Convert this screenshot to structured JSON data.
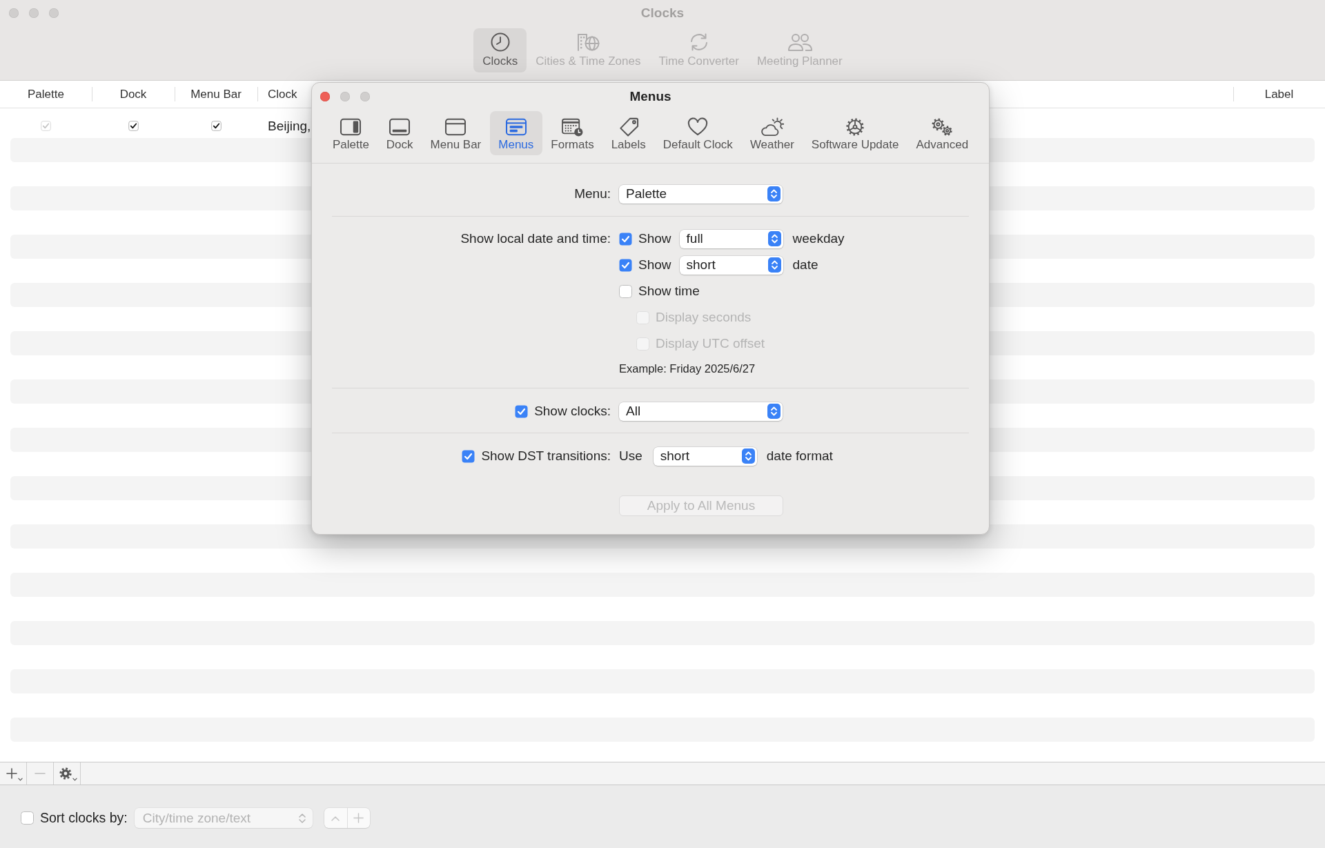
{
  "window": {
    "title": "Clocks"
  },
  "toolbar": [
    {
      "label": "Clocks",
      "selected": true
    },
    {
      "label": "Cities & Time Zones",
      "selected": false
    },
    {
      "label": "Time Converter",
      "selected": false
    },
    {
      "label": "Meeting Planner",
      "selected": false
    }
  ],
  "table": {
    "columns": [
      "Palette",
      "Dock",
      "Menu Bar",
      "Clock",
      "Label"
    ],
    "rows": [
      {
        "palette": {
          "checked": true,
          "disabled": true
        },
        "dock": {
          "checked": true,
          "disabled": false
        },
        "menu_bar": {
          "checked": true,
          "disabled": false
        },
        "clock": "Beijing,"
      }
    ]
  },
  "footer_buttons": [
    {
      "kind": "add",
      "disabled": false
    },
    {
      "kind": "remove",
      "disabled": true
    },
    {
      "kind": "action",
      "disabled": false
    }
  ],
  "sort": {
    "checked": false,
    "label": "Sort clocks by:",
    "popup": {
      "value": "City/time zone/text",
      "disabled": true
    },
    "segments": [
      {
        "kind": "ascending",
        "disabled": true
      },
      {
        "kind": "add",
        "disabled": true
      }
    ]
  },
  "dialog": {
    "title": "Menus",
    "tabs": [
      {
        "label": "Palette",
        "selected": false
      },
      {
        "label": "Dock",
        "selected": false
      },
      {
        "label": "Menu Bar",
        "selected": false
      },
      {
        "label": "Menus",
        "selected": true
      },
      {
        "label": "Formats",
        "selected": false
      },
      {
        "label": "Labels",
        "selected": false
      },
      {
        "label": "Default Clock",
        "selected": false
      },
      {
        "label": "Weather",
        "selected": false
      },
      {
        "label": "Software Update",
        "selected": false
      },
      {
        "label": "Advanced",
        "selected": false
      }
    ],
    "menu": {
      "label": "Menu:",
      "value": "Palette"
    },
    "local_date_time": {
      "label": "Show local date and time:",
      "options": [
        {
          "kind": "popup",
          "checked": true,
          "disabled": false,
          "label": "Show",
          "value": "full",
          "suffix": "weekday"
        },
        {
          "kind": "popup",
          "checked": true,
          "disabled": false,
          "label": "Show",
          "value": "short",
          "suffix": "date"
        },
        {
          "kind": "check",
          "checked": false,
          "disabled": false,
          "label": "Show time",
          "children": [
            {
              "checked": false,
              "disabled": true,
              "label": "Display seconds"
            },
            {
              "checked": false,
              "disabled": true,
              "label": "Display UTC offset"
            }
          ]
        }
      ],
      "example": "Example: Friday 2025/6/27"
    },
    "show_clocks": {
      "checked": true,
      "label": "Show clocks:",
      "value": "All"
    },
    "dst": {
      "checked": true,
      "label": "Show DST transitions:",
      "prefix": "Use",
      "value": "short",
      "suffix": "date format"
    },
    "apply_button": {
      "label": "Apply to All Menus",
      "disabled": true
    }
  }
}
